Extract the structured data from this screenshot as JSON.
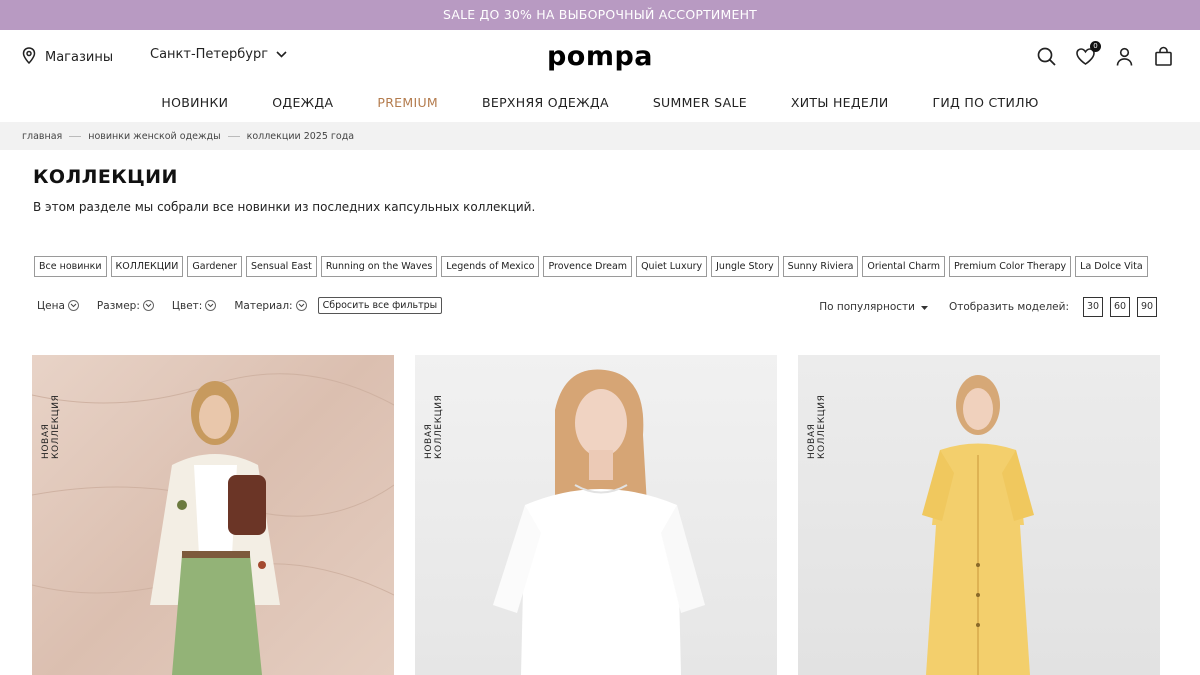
{
  "promo": {
    "text": "SALE ДО 30% НА ВЫБОРОЧНЫЙ АССОРТИМЕНТ"
  },
  "header": {
    "stores_label": "Магазины",
    "city": "Санкт-Петербург",
    "logo": "pompa",
    "favorites_count": "0"
  },
  "nav": {
    "items": [
      {
        "label": "НОВИНКИ"
      },
      {
        "label": "ОДЕЖДА"
      },
      {
        "label": "PREMIUM"
      },
      {
        "label": "ВЕРХНЯЯ ОДЕЖДА"
      },
      {
        "label": "SUMMER SALE"
      },
      {
        "label": "ХИТЫ НЕДЕЛИ"
      },
      {
        "label": "ГИД ПО СТИЛЮ"
      }
    ]
  },
  "breadcrumbs": [
    "главная",
    "новинки женской одежды",
    "коллекции 2025 года"
  ],
  "page": {
    "title": "КОЛЛЕКЦИИ",
    "description": "В этом разделе мы собрали все новинки из последних капсульных коллекций."
  },
  "tags": [
    "Все новинки",
    "КОЛЛЕКЦИИ",
    "Gardener",
    "Sensual East",
    "Running on the Waves",
    "Legends of Mexico",
    "Provence Dream",
    "Quiet Luxury",
    "Jungle Story",
    "Sunny Riviera",
    "Oriental Charm",
    "Premium Color Therapy",
    "La Dolce Vita"
  ],
  "filters": {
    "price": "Цена",
    "size": "Размер:",
    "color": "Цвет:",
    "material": "Материал:",
    "reset": "Сбросить все фильтры"
  },
  "sorting": {
    "sort_label": "По популярности",
    "show_label": "Отобразить моделей:",
    "counts": [
      "30",
      "60",
      "90"
    ]
  },
  "products": [
    {
      "badge": "НОВАЯ КОЛЛЕКЦИЯ"
    },
    {
      "badge": "НОВАЯ КОЛЛЕКЦИЯ"
    },
    {
      "badge": "НОВАЯ КОЛЛЕКЦИЯ"
    }
  ],
  "colors": {
    "promo_bg": "#b89ac2",
    "premium_accent": "#b47c4e",
    "breadcrumb_bg": "#f2f2f2"
  }
}
